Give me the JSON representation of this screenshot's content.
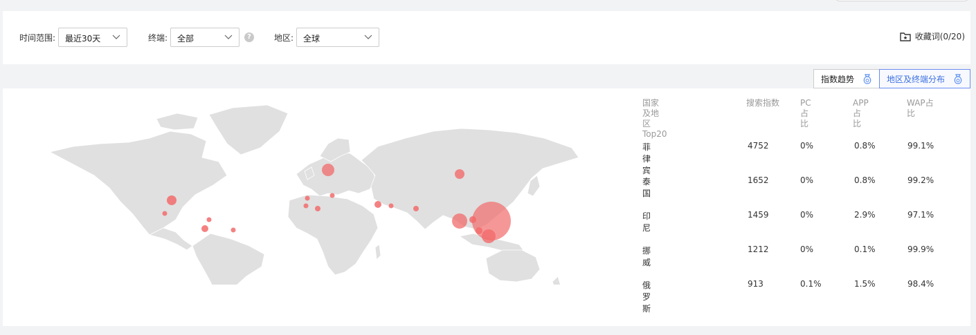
{
  "filters": {
    "time": {
      "label": "时间范围:",
      "value": "最近30天"
    },
    "device": {
      "label": "终端:",
      "value": "全部"
    },
    "region": {
      "label": "地区:",
      "value": "全球"
    },
    "help_glyph": "?",
    "favorites_label": "收藏词(0/20)"
  },
  "tabs": [
    {
      "label": "指数趋势",
      "active": false
    },
    {
      "label": "地区及终端分布",
      "active": true
    }
  ],
  "table": {
    "headers": {
      "country": "国家及地区Top20",
      "search_index": "搜索指数",
      "pc": "PC占比",
      "app": "APP占比",
      "wap": "WAP占比"
    },
    "rows": [
      {
        "country": "菲律宾",
        "index": "4752",
        "pc": "0%",
        "app": "0.8%",
        "wap": "99.1%"
      },
      {
        "country": "泰国",
        "index": "1652",
        "pc": "0%",
        "app": "0.8%",
        "wap": "99.2%"
      },
      {
        "country": "印尼",
        "index": "1459",
        "pc": "0%",
        "app": "2.9%",
        "wap": "97.1%"
      },
      {
        "country": "挪威",
        "index": "1212",
        "pc": "0%",
        "app": "0.1%",
        "wap": "99.9%"
      },
      {
        "country": "俄罗斯",
        "index": "913",
        "pc": "0.1%",
        "app": "1.5%",
        "wap": "98.4%"
      }
    ]
  },
  "map": {
    "land_color": "#e0e0e0",
    "bubble_color": "#f26b6b"
  }
}
